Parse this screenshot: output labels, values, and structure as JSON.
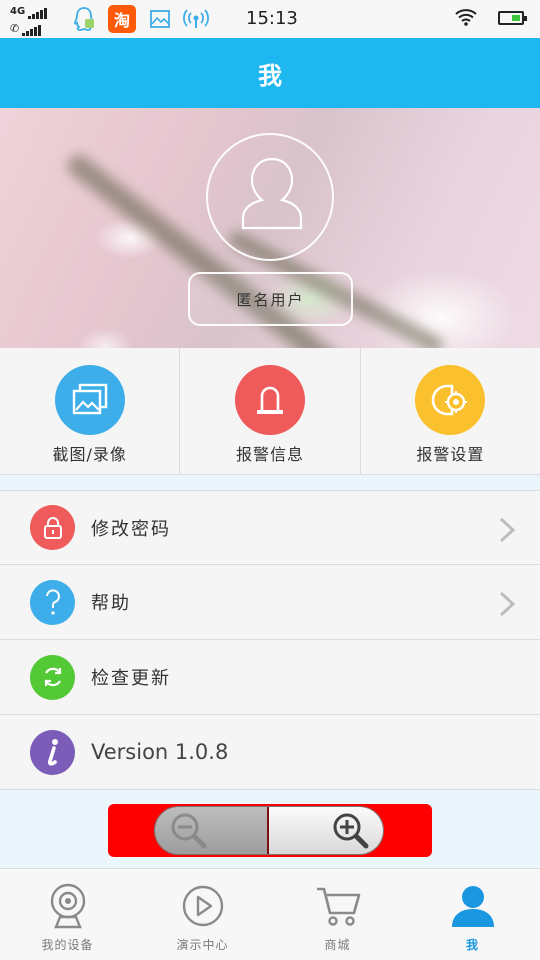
{
  "status_bar": {
    "network_type": "4G",
    "time": "15:13",
    "notification_icons": [
      "qq-icon",
      "taobao-icon",
      "gallery-icon",
      "hotspot-icon"
    ],
    "taobao_glyph": "淘"
  },
  "header": {
    "title": "我"
  },
  "profile": {
    "username": "匿名用户"
  },
  "quick_actions": [
    {
      "label": "截图/录像",
      "icon": "picture-icon",
      "color": "#3daee9"
    },
    {
      "label": "报警信息",
      "icon": "alarm-light-icon",
      "color": "#ef5b5b"
    },
    {
      "label": "报警设置",
      "icon": "alarm-settings-icon",
      "color": "#fbc02d"
    }
  ],
  "menu": [
    {
      "label": "修改密码",
      "icon": "lock-icon",
      "color": "#ef5b5b",
      "has_arrow": true
    },
    {
      "label": "帮助",
      "icon": "question-icon",
      "color": "#3daee9",
      "has_arrow": true
    },
    {
      "label": "检查更新",
      "icon": "refresh-icon",
      "color": "#52c935",
      "has_arrow": false
    },
    {
      "label": "Version 1.0.8",
      "icon": "info-icon",
      "color": "#7b5cb8",
      "has_arrow": false
    }
  ],
  "bottom_nav": [
    {
      "label": "我的设备",
      "icon": "camera-icon",
      "active": false
    },
    {
      "label": "演示中心",
      "icon": "play-icon",
      "active": false
    },
    {
      "label": "商城",
      "icon": "cart-icon",
      "active": false
    },
    {
      "label": "我",
      "icon": "user-icon",
      "active": true
    }
  ],
  "colors": {
    "accent": "#1eb7ef",
    "active_nav": "#1a97e0",
    "zoom_bg": "#ff0000"
  }
}
